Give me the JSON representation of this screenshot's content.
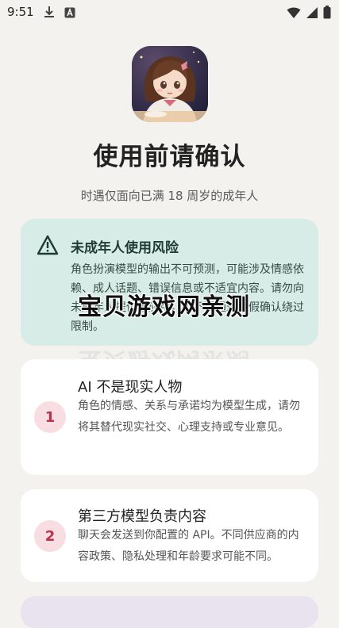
{
  "status_bar": {
    "time": "9:51",
    "icons_left": [
      "download-icon",
      "a-box-icon"
    ],
    "icons_right": [
      "wifi-icon",
      "signal-icon",
      "battery-icon"
    ]
  },
  "header": {
    "title": "使用前请确认",
    "subtitle": "时遇仅面向已满 18 周岁的成年人"
  },
  "warning": {
    "title": "未成年人使用风险",
    "body": "角色扮演模型的输出不可预测，可能涉及情感依赖、成人话题、错误信息或不适宜内容。请勿向未成年人提供本应用，也不要通过虚假确认绕过限制。",
    "color": "#d7ece6"
  },
  "watermark": "宝贝游戏网亲测",
  "items": [
    {
      "number": "1",
      "title": "AI 不是现实人物",
      "body": "角色的情感、关系与承诺均为模型生成，请勿将其替代现实社交、心理支持或专业意见。"
    },
    {
      "number": "2",
      "title": "第三方模型负责内容",
      "body": "聊天会发送到你配置的 API。不同供应商的内容政策、隐私处理和年龄要求可能不同。"
    }
  ],
  "colors": {
    "background": "#f3f2ee",
    "badge_bg": "#f8dde2",
    "badge_text": "#b9334a"
  }
}
